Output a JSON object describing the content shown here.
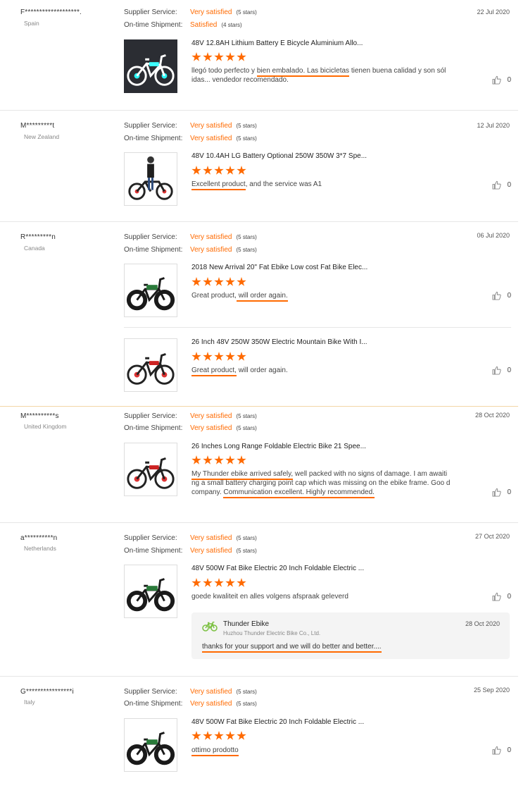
{
  "labels": {
    "supplier_service": "Supplier Service:",
    "on_time_shipment": "On-time Shipment:"
  },
  "colors": {
    "accent": "#ff6a00",
    "bike_green": "#7cc142"
  },
  "reviews": [
    {
      "name": "F*******************.",
      "country": "Spain",
      "date": "22 Jul 2020",
      "supplier_rating": "Very satisfied",
      "supplier_stars": "(5 stars)",
      "shipment_rating": "Satisfied",
      "shipment_stars": "(4 stars)",
      "products": [
        {
          "title": "48V 12.8AH Lithium Battery E Bicycle Aluminium Allo...",
          "stars": 5,
          "text_a": "llegó todo perfecto y ",
          "text_hl": "bien embalado. Las bicicletas",
          "text_b": " tienen buena calidad y son sól idas... vendedor recomendado.",
          "likes": "0"
        }
      ]
    },
    {
      "name": "M*********t",
      "country": "New Zealand",
      "date": "12 Jul 2020",
      "supplier_rating": "Very satisfied",
      "supplier_stars": "(5 stars)",
      "shipment_rating": "Very satisfied",
      "shipment_stars": "(5 stars)",
      "products": [
        {
          "title": "48V 10.4AH LG Battery Optional 250W 350W 3*7 Spe...",
          "stars": 5,
          "text_a": "",
          "text_hl": "Excellent product",
          "text_b": ", and the service was A1",
          "likes": "0"
        }
      ]
    },
    {
      "name": "R*********n",
      "country": "Canada",
      "date": "06 Jul 2020",
      "supplier_rating": "Very satisfied",
      "supplier_stars": "(5 stars)",
      "shipment_rating": "Very satisfied",
      "shipment_stars": "(5 stars)",
      "products": [
        {
          "title": "2018 New Arrival 20\" Fat Ebike Low cost Fat Bike Elec...",
          "stars": 5,
          "text_a": "Great product,",
          "text_hl": " will order again.",
          "text_b": "",
          "likes": "0"
        },
        {
          "title": "26 Inch 48V 250W 350W Electric Mountain Bike With I...",
          "stars": 5,
          "text_a": "",
          "text_hl": "Great product,",
          "text_b": " will order again.",
          "likes": "0"
        }
      ]
    },
    {
      "name": "M**********s",
      "country": "United Kingdom",
      "date": "28 Oct 2020",
      "supplier_rating": "Very satisfied",
      "supplier_stars": "(5 stars)",
      "shipment_rating": "Very satisfied",
      "shipment_stars": "(5 stars)",
      "products": [
        {
          "title": "26 Inches Long Range Foldable Electric Bike 21 Spee...",
          "stars": 5,
          "text_hl1": "My Thunder ebike arrived safely,",
          "text_mid": " well packed with no signs of damage. I am awaiti ng a small battery charging point cap which was missing on the ebike frame. Goo d company. ",
          "text_hl2": "Communication excellent. Highly recommended.",
          "likes": "0"
        }
      ]
    },
    {
      "name": "a**********n",
      "country": "Netherlands",
      "date": "27 Oct 2020",
      "supplier_rating": "Very satisfied",
      "supplier_stars": "(5 stars)",
      "shipment_rating": "Very satisfied",
      "shipment_stars": "(5 stars)",
      "products": [
        {
          "title": "48V 500W Fat Bike Electric 20 Inch Foldable Electric ...",
          "stars": 5,
          "text_a": "goede kwaliteit en alles volgens afspraak geleverd",
          "likes": "0"
        }
      ],
      "reply": {
        "seller": "Thunder Ebike",
        "company": "Huzhou Thunder Electric Bike Co., Ltd.",
        "date": "28 Oct 2020",
        "text": "thanks for your support and we will do better and better...."
      }
    },
    {
      "name": "G****************i",
      "country": "Italy",
      "date": "25 Sep 2020",
      "supplier_rating": "Very satisfied",
      "supplier_stars": "(5 stars)",
      "shipment_rating": "Very satisfied",
      "shipment_stars": "(5 stars)",
      "products": [
        {
          "title": "48V 500W Fat Bike Electric 20 Inch Foldable Electric ...",
          "stars": 5,
          "text_hl": "ottimo prodotto",
          "likes": "0"
        }
      ]
    }
  ]
}
